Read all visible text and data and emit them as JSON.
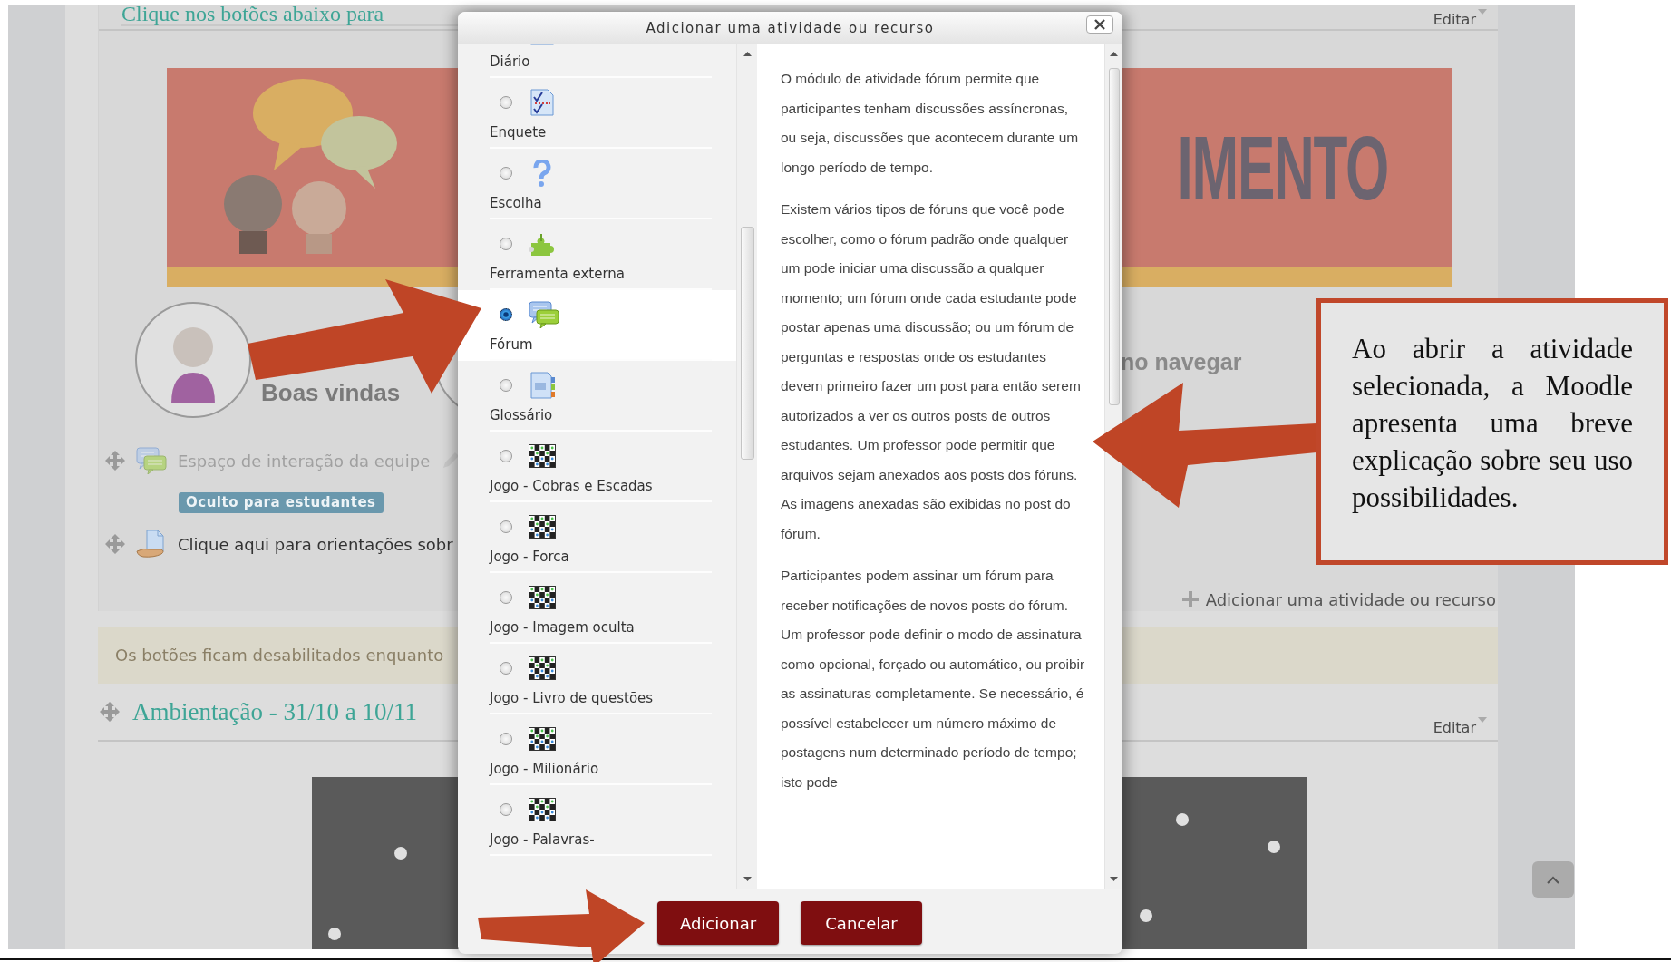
{
  "course_page": {
    "section_title": "Clique nos botões abaixo para",
    "edit_menu": "Editar",
    "banner": {
      "text": "IMENTO"
    },
    "welcome": {
      "title": "Boas vindas",
      "next_title": "no navegar"
    },
    "activities": [
      {
        "kind": "forum",
        "title": "Espaço de interação da equipe",
        "hidden": true,
        "badge": "Oculto para estudantes"
      },
      {
        "kind": "file",
        "title": "Clique aqui para orientações sobr",
        "hidden": false
      }
    ],
    "add_activity": "Adicionar uma atividade ou recurso",
    "notice": "Os botões ficam desabilitados enquanto",
    "next_section": {
      "title": "Ambientação - 31/10 a 10/11",
      "edit_menu": "Editar"
    }
  },
  "dialog": {
    "title": "Adicionar uma atividade ou recurso",
    "modules": [
      {
        "label": "Diário",
        "kind": "journal",
        "selected": false
      },
      {
        "label": "Enquete",
        "kind": "poll",
        "selected": false
      },
      {
        "label": "Escolha",
        "kind": "choice",
        "selected": false
      },
      {
        "label": "Ferramenta externa",
        "kind": "tool",
        "selected": false
      },
      {
        "label": "Fórum",
        "kind": "forum",
        "selected": true
      },
      {
        "label": "Glossário",
        "kind": "glossary",
        "selected": false
      },
      {
        "label": "Jogo - Cobras e Escadas",
        "kind": "game",
        "selected": false
      },
      {
        "label": "Jogo - Forca",
        "kind": "game",
        "selected": false
      },
      {
        "label": "Jogo - Imagem oculta",
        "kind": "game",
        "selected": false
      },
      {
        "label": "Jogo - Livro de questões",
        "kind": "game",
        "selected": false
      },
      {
        "label": "Jogo - Milionário",
        "kind": "game",
        "selected": false
      },
      {
        "label": "Jogo - Palavras-",
        "kind": "game",
        "selected": false
      }
    ],
    "description": [
      "O módulo de atividade fórum permite que participantes tenham discussões assíncronas, ou seja, discussões que acontecem durante um longo período de tempo.",
      "Existem vários tipos de fóruns que você pode escolher, como o fórum padrão onde qualquer um pode iniciar uma discussão a qualquer momento; um fórum onde cada estudante pode postar apenas uma discussão; ou um fórum de perguntas e respostas onde os estudantes devem primeiro fazer um post para então serem autorizados a ver os outros posts de outros estudantes. Um professor pode permitir que arquivos sejam anexados aos posts dos fóruns. As imagens anexadas são exibidas no post do fórum.",
      "Participantes podem assinar um fórum para receber notificações de novos posts do fórum. Um professor pode definir o modo de assinatura como opcional, forçado ou automático, ou proibir as assinaturas completamente. Se necessário, é possível estabelecer um número máximo de postagens num determinado período de tempo; isto pode"
    ],
    "buttons": [
      "Adicionar",
      "Cancelar"
    ]
  },
  "callout": {
    "text": "Ao abrir a atividade selecionada, a Moodle apresenta uma breve explicação sobre seu uso possibilidades."
  }
}
